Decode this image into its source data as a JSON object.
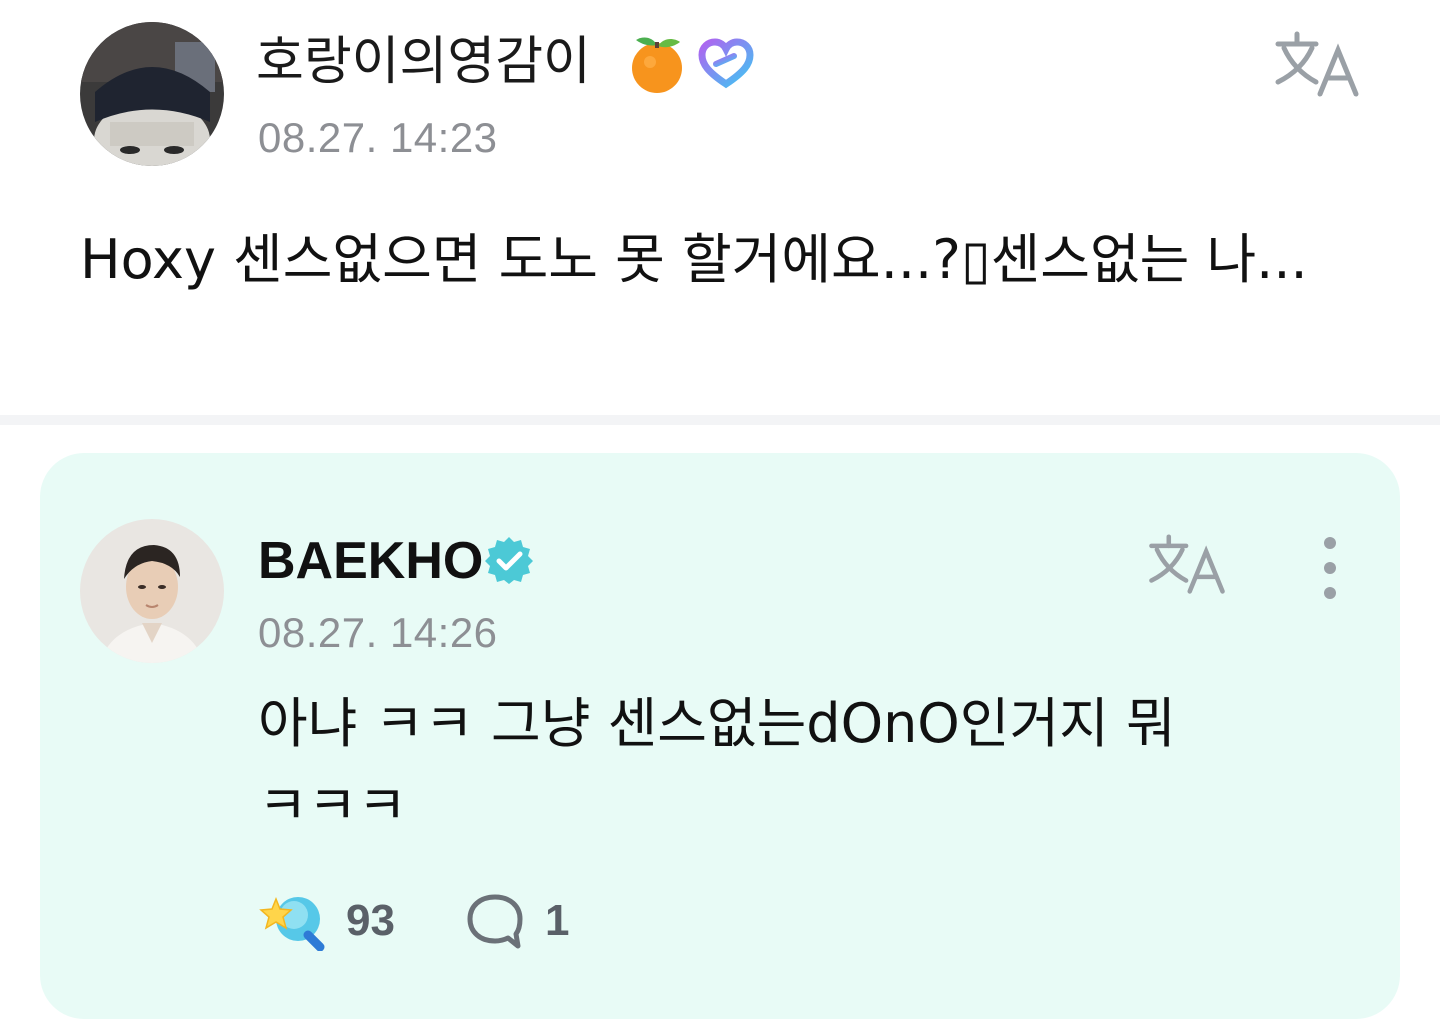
{
  "post": {
    "author_name": "호랑이의영감이",
    "timestamp": "08.27. 14:23",
    "body": "Hoxy 센스없으면 도노 못 할거에요...?▯센스없는 나...",
    "icons": [
      "tangerine-emoji",
      "membership-heart-icon",
      "translate-icon"
    ]
  },
  "reply": {
    "author_name": "BAEKHO",
    "timestamp": "08.27. 14:26",
    "body_line1": "아냐 ㅋㅋ 그냥 센스없는dOnO인거지 뭐",
    "body_line2": "ㅋㅋㅋ",
    "like_count": "93",
    "comment_count": "1",
    "icons": [
      "verified-badge-icon",
      "translate-icon",
      "more-vertical-icon",
      "like-sticker-icon",
      "comment-bubble-icon"
    ]
  },
  "colors": {
    "card_bg": "#e8fbf6",
    "verified": "#4cc9d6",
    "timestamp": "#8d8f94",
    "icon_gray": "#9aa0a6"
  }
}
